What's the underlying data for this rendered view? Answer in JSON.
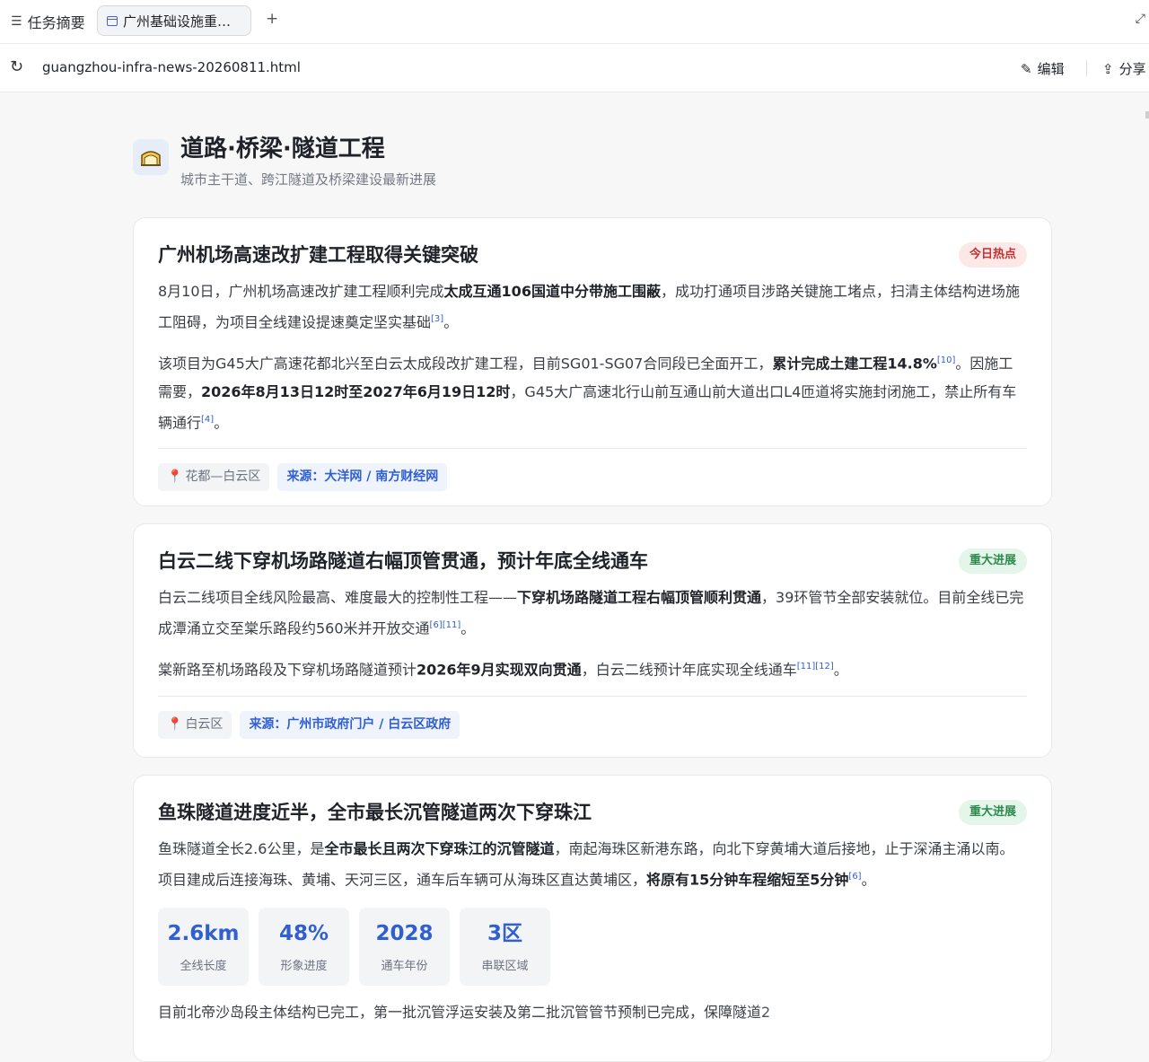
{
  "tabbar": {
    "summary_label": "任务摘要",
    "active_tab_label": "广州基础设施重…",
    "new_tab": "+"
  },
  "addressbar": {
    "url": "guangzhou-infra-news-20260811.html",
    "edit_label": "编辑",
    "share_label": "分享"
  },
  "section": {
    "title": "道路·桥梁·隧道工程",
    "subtitle": "城市主干道、跨江隧道及桥梁建设最新进展"
  },
  "cards": [
    {
      "title": "广州机场高速改扩建工程取得关键突破",
      "badge": "今日热点",
      "p1": {
        "a": "8月10日，广州机场高速改扩建工程顺利完成",
        "b": "太成互通106国道中分带施工围蔽",
        "c": "，成功打通项目涉路关键施工堵点，扫清主体结构进场施工阻碍，为项目全线建设提速奠定坚实基础",
        "ref": "[3]",
        "d": "。"
      },
      "p2": {
        "a": "该项目为G45大广高速花都北兴至白云太成段改扩建工程，目前SG01-SG07合同段已全面开工，",
        "b": "累计完成土建工程14.8%",
        "ref1": "[10]",
        "c": "。因施工需要，",
        "d": "2026年8月13日12时至2027年6月19日12时",
        "e": "，G45大广高速北行山前互通山前大道出口L4匝道将实施封闭施工，禁止所有车辆通行",
        "ref2": "[4]",
        "f": "。"
      },
      "location": "花都—白云区",
      "source": "来源：大洋网 / 南方财经网"
    },
    {
      "title": "白云二线下穿机场路隧道右幅顶管贯通，预计年底全线通车",
      "badge": "重大进展",
      "p1": {
        "a": "白云二线项目全线风险最高、难度最大的控制性工程——",
        "b": "下穿机场路隧道工程右幅顶管顺利贯通",
        "c": "，39环管节全部安装就位。目前全线已完成潭涌立交至棠乐路段约560米并开放交通",
        "ref": "[6][11]",
        "d": "。"
      },
      "p2": {
        "a": "棠新路至机场路段及下穿机场路隧道预计",
        "b": "2026年9月实现双向贯通",
        "c": "，白云二线预计年底实现全线通车",
        "ref": "[11][12]",
        "d": "。"
      },
      "location": "白云区",
      "source": "来源：广州市政府门户 / 白云区政府"
    },
    {
      "title": "鱼珠隧道进度近半，全市最长沉管隧道两次下穿珠江",
      "badge": "重大进展",
      "p1": {
        "a": "鱼珠隧道全长2.6公里，是",
        "b": "全市最长且两次下穿珠江的沉管隧道",
        "c": "，南起海珠区新港东路，向北下穿黄埔大道后接地，止于深涌主涌以南。项目建成后连接海珠、黄埔、天河三区，通车后车辆可从海珠区直达黄埔区，",
        "d": "将原有15分钟车程缩短至5分钟",
        "ref": "[6]",
        "e": "。"
      },
      "stats": [
        {
          "value": "2.6km",
          "label": "全线长度"
        },
        {
          "value": "48%",
          "label": "形象进度"
        },
        {
          "value": "2028",
          "label": "通车年份"
        },
        {
          "value": "3区",
          "label": "串联区域"
        }
      ],
      "p2": "目前北帝沙岛段主体结构已完工，第一批沉管浮运安装及第二批沉管管节预制已完成，保障隧道2"
    }
  ]
}
